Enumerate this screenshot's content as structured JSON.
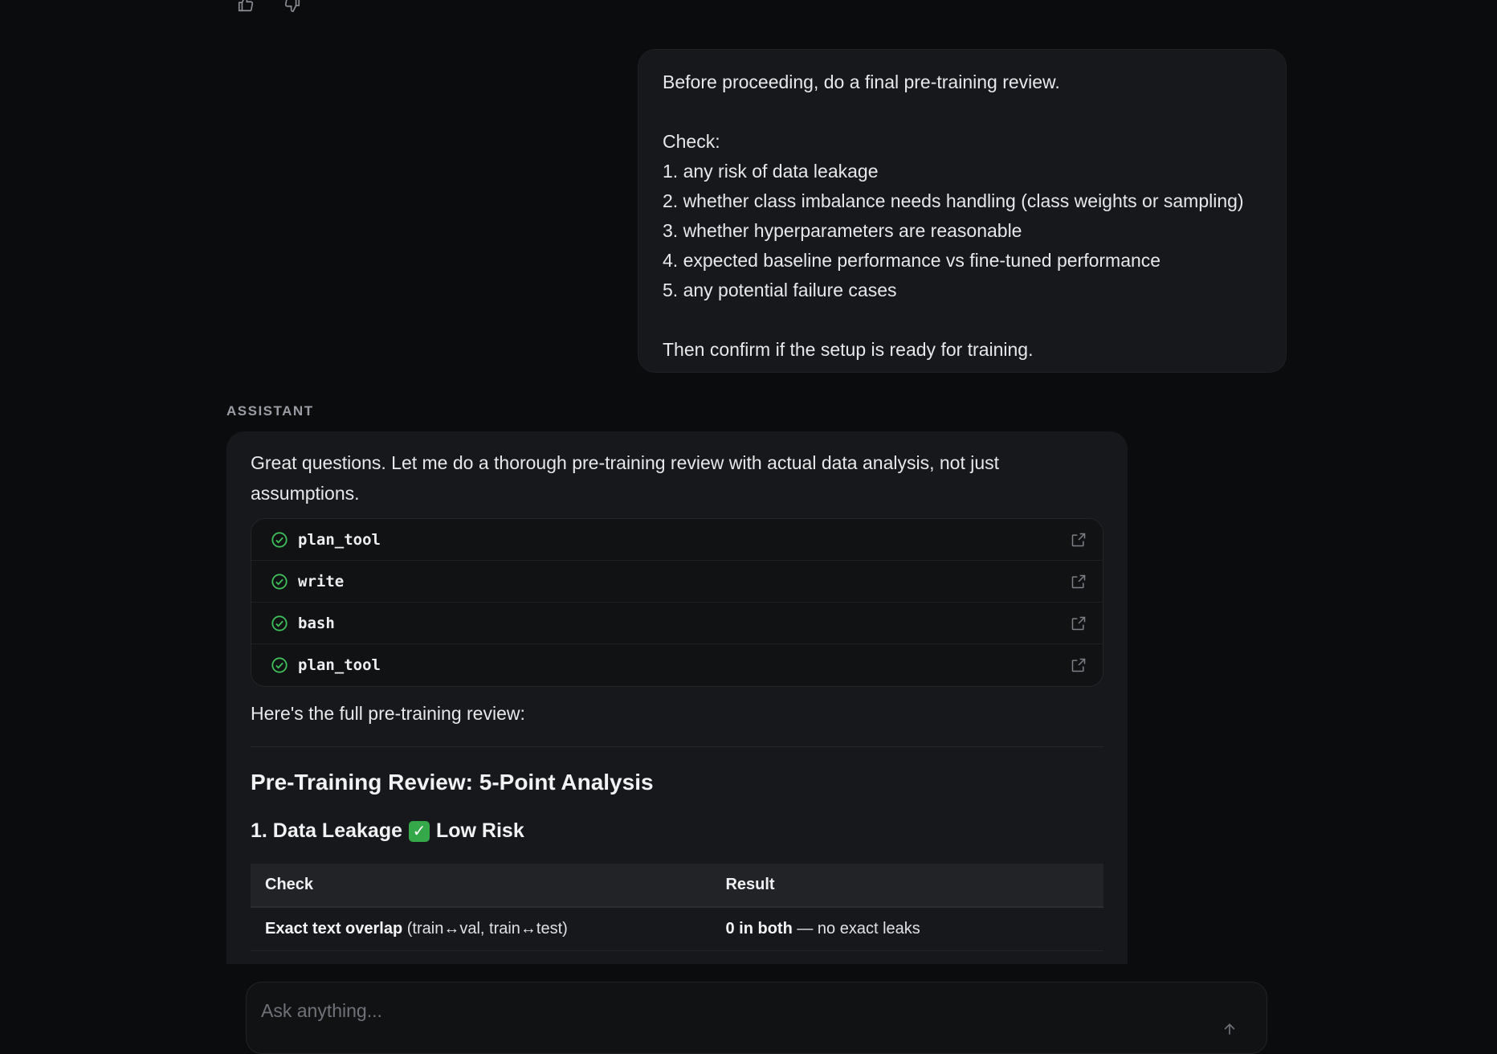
{
  "feedback": {
    "like_icon": "thumbs-up-icon",
    "dislike_icon": "thumbs-down-icon"
  },
  "user_message": {
    "line1": "Before proceeding, do a final pre-training review.",
    "check_label": "Check:",
    "items": [
      "1. any risk of data leakage",
      "2. whether class imbalance needs handling (class weights or sampling)",
      "3. whether hyperparameters are reasonable",
      "4. expected baseline performance vs fine-tuned performance",
      "5. any potential failure cases"
    ],
    "closing": "Then confirm if the setup is ready for training."
  },
  "assistant": {
    "role_label": "ASSISTANT",
    "intro": "Great questions. Let me do a thorough pre-training review with actual data analysis, not just assumptions.",
    "tools": [
      {
        "name": "plan_tool",
        "status": "completed"
      },
      {
        "name": "write",
        "status": "completed"
      },
      {
        "name": "bash",
        "status": "completed"
      },
      {
        "name": "plan_tool",
        "status": "completed"
      }
    ],
    "lead": "Here's the full pre-training review:",
    "heading": "Pre-Training Review: 5-Point Analysis",
    "section1": {
      "prefix": "1. Data Leakage",
      "emoji": "✓",
      "suffix": "Low Risk"
    },
    "table": {
      "headers": [
        "Check",
        "Result"
      ],
      "rows": [
        {
          "check_bold": "Exact text overlap",
          "check_rest": " (train↔val, train↔test)",
          "result_bold": "0 in both",
          "result_rest": " — no exact leaks"
        }
      ]
    }
  },
  "composer": {
    "placeholder": "Ask anything..."
  },
  "colors": {
    "success": "#35a84a",
    "background": "#0b0c0e",
    "card": "#17181b"
  }
}
